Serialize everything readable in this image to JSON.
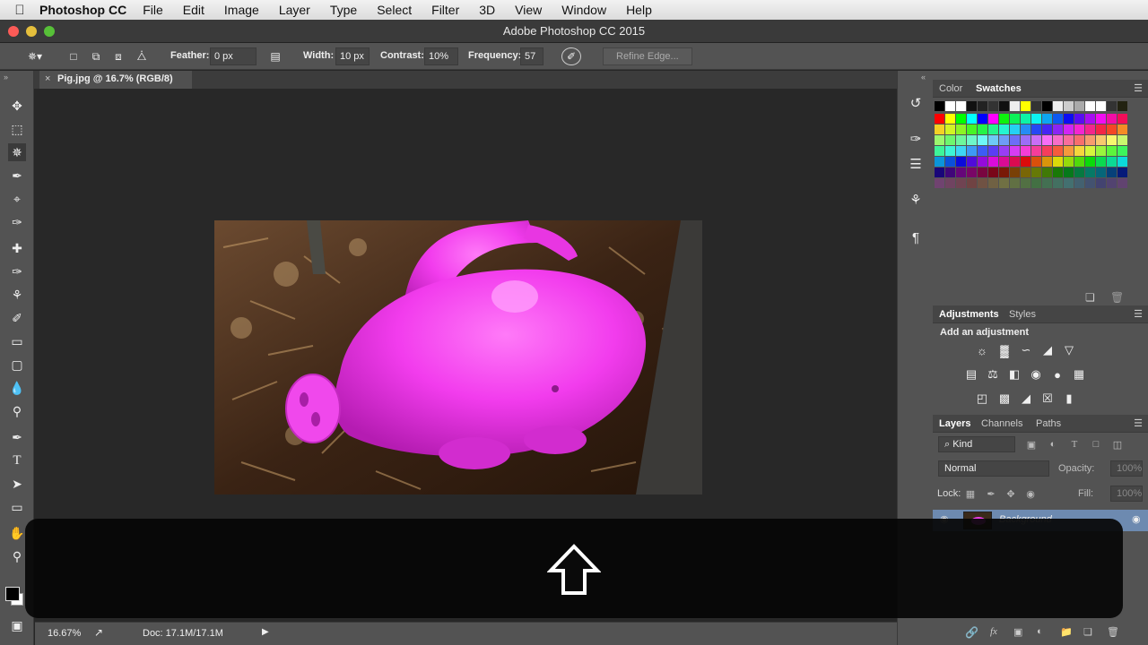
{
  "menubar": {
    "app": "Photoshop CC",
    "items": [
      "File",
      "Edit",
      "Image",
      "Layer",
      "Type",
      "Select",
      "Filter",
      "3D",
      "View",
      "Window",
      "Help"
    ]
  },
  "window": {
    "title": "Adobe Photoshop CC 2015"
  },
  "options": {
    "feather_label": "Feather:",
    "feather_value": "0 px",
    "width_label": "Width:",
    "width_value": "10 px",
    "contrast_label": "Contrast:",
    "contrast_value": "10%",
    "frequency_label": "Frequency:",
    "frequency_value": "57",
    "refine_edge": "Refine Edge..."
  },
  "document": {
    "tab": "Pig.jpg @ 16.7% (RGB/8)",
    "close": "×"
  },
  "status": {
    "zoom": "16.67%",
    "doc": "Doc: 17.1M/17.1M"
  },
  "color_panel": {
    "tabs": [
      "Color",
      "Swatches"
    ],
    "active": "Swatches"
  },
  "adjustments_panel": {
    "tabs": [
      "Adjustments",
      "Styles"
    ],
    "heading": "Add an adjustment"
  },
  "layers_panel": {
    "tabs": [
      "Layers",
      "Channels",
      "Paths"
    ],
    "filter": "Kind",
    "blend": "Normal",
    "opacity_label": "Opacity:",
    "opacity": "100%",
    "lock_label": "Lock:",
    "fill_label": "Fill:",
    "fill": "100%",
    "layer_name": "Background"
  },
  "colors": {
    "pig": "#f03cec",
    "ps_panel": "#535353",
    "canvas": "#282828"
  }
}
